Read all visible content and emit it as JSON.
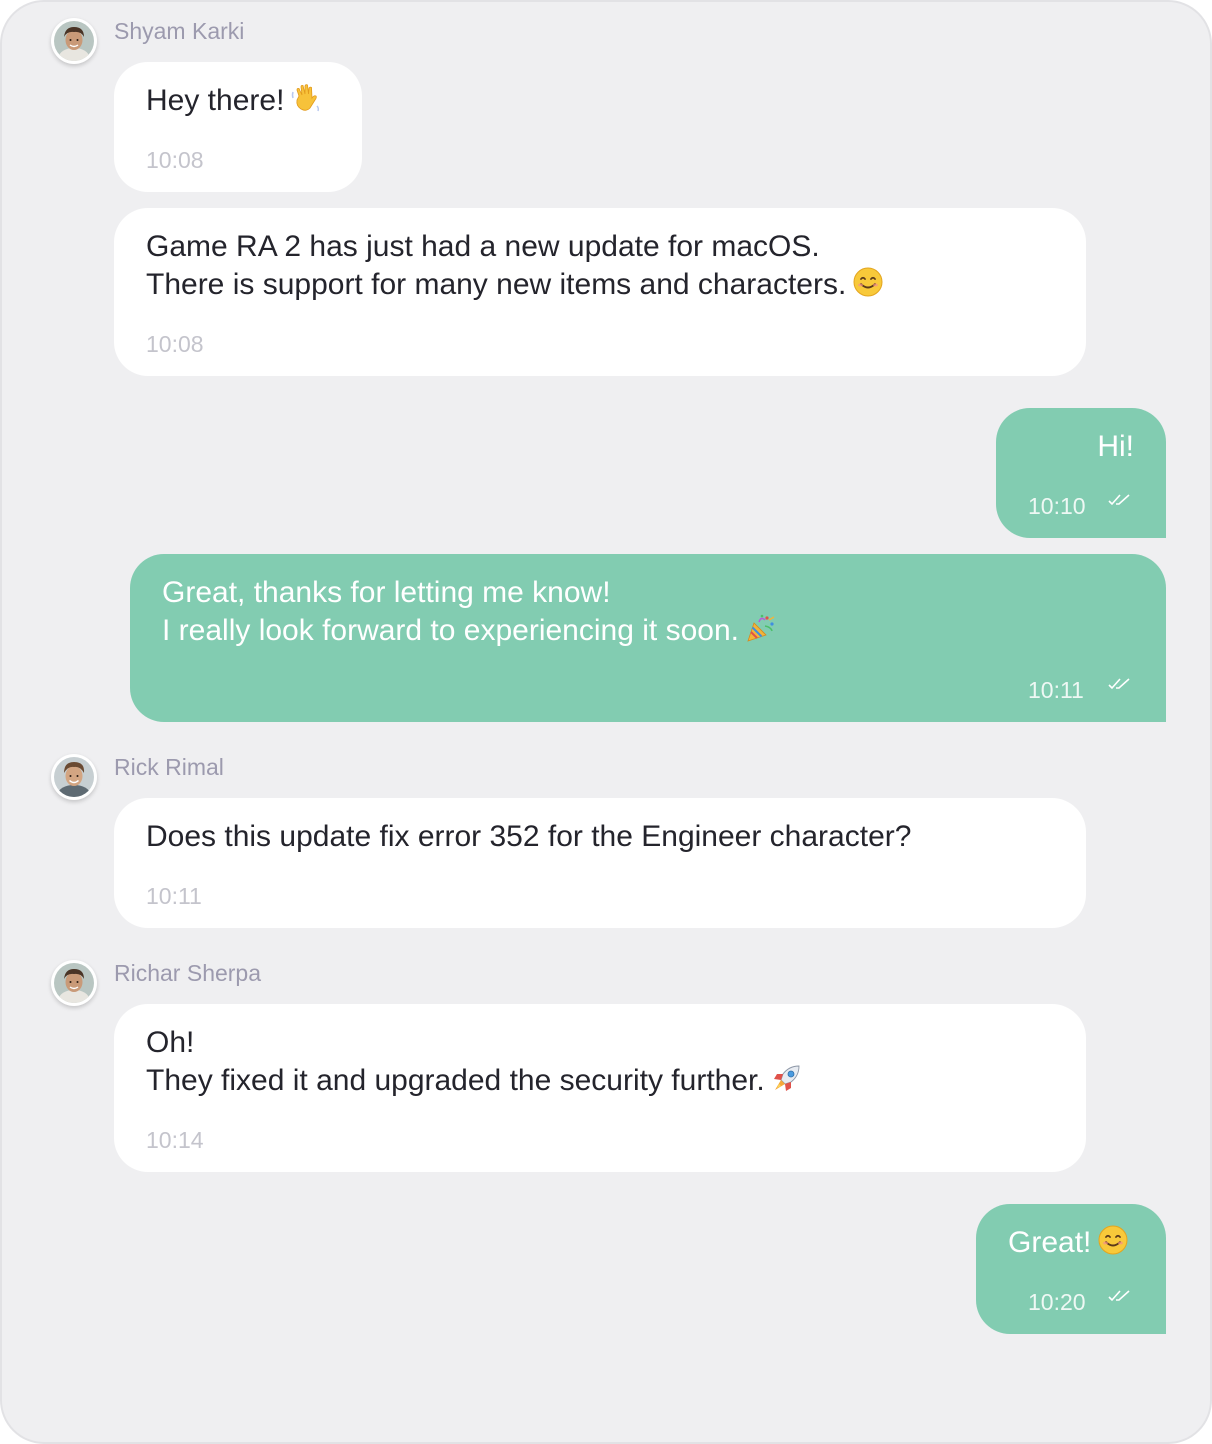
{
  "messages": [
    {
      "sender": "Shyam Karki",
      "lines": [
        "Hey there!"
      ],
      "emoji": "waving-hand-icon",
      "time": "10:08"
    },
    {
      "lines": [
        "Game RA 2 has just had a new update for macOS.",
        "There is support for many new items and characters."
      ],
      "emoji": "smiling-face-icon",
      "time": "10:08"
    },
    {
      "outgoing": true,
      "lines": [
        "Hi!"
      ],
      "time": "10:10",
      "status_icon": "double-check-icon"
    },
    {
      "outgoing": true,
      "lines": [
        "Great, thanks for letting me know!",
        "I really look forward to experiencing it soon."
      ],
      "emoji": "party-popper-icon",
      "time": "10:11",
      "status_icon": "double-check-icon"
    },
    {
      "sender": "Rick Rimal",
      "lines": [
        "Does this update fix error 352 for the Engineer character?"
      ],
      "time": "10:11"
    },
    {
      "sender": "Richar Sherpa",
      "lines": [
        "Oh!",
        "They fixed it and upgraded the security further."
      ],
      "emoji": "rocket-icon",
      "time": "10:14"
    },
    {
      "outgoing": true,
      "lines": [
        "Great!"
      ],
      "emoji": "smiling-face-icon",
      "time": "10:20",
      "status_icon": "double-check-icon"
    }
  ],
  "colors": {
    "background": "#efeff1",
    "incoming_bubble": "#ffffff",
    "outgoing_bubble": "#82ccb1",
    "sender_name": "#9c9aae",
    "timestamp": "#c4c4cc"
  }
}
